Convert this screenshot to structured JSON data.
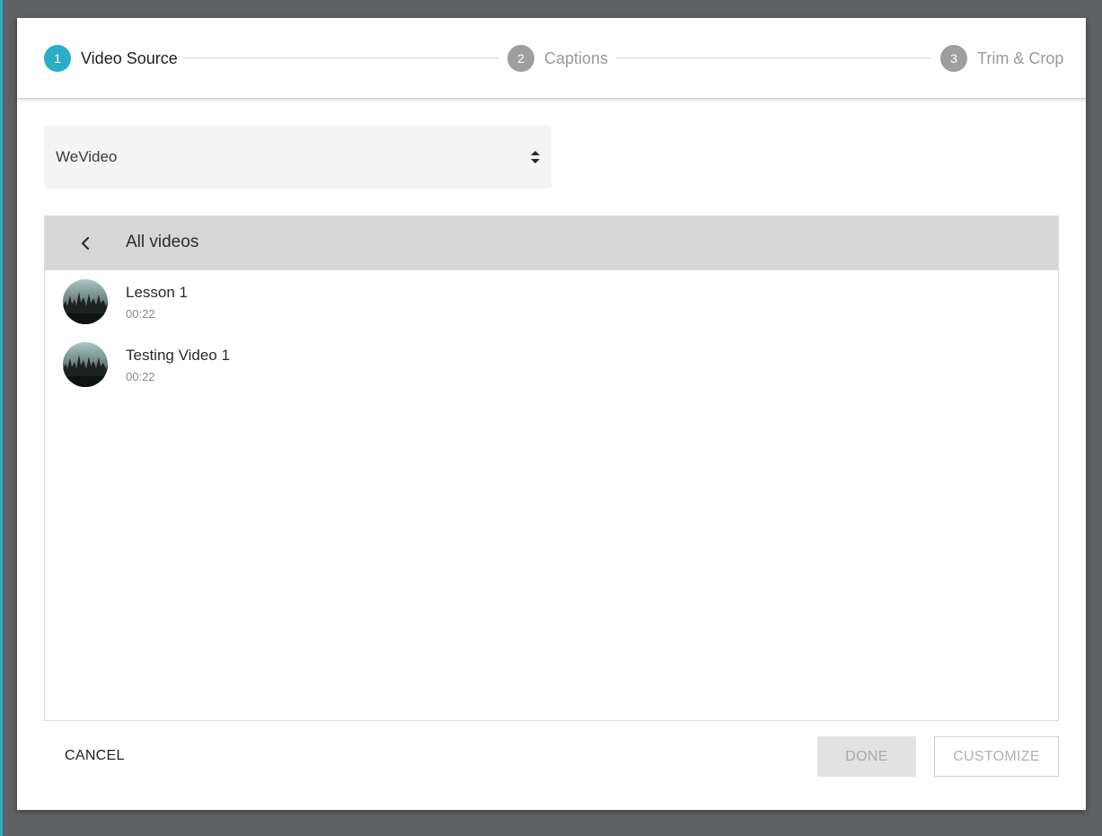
{
  "steps": [
    {
      "number": "1",
      "label": "Video Source",
      "active": true
    },
    {
      "number": "2",
      "label": "Captions",
      "active": false
    },
    {
      "number": "3",
      "label": "Trim & Crop",
      "active": false
    }
  ],
  "source": {
    "selected": "WeVideo"
  },
  "list": {
    "title": "All videos",
    "items": [
      {
        "title": "Lesson 1",
        "duration": "00:22"
      },
      {
        "title": "Testing Video 1",
        "duration": "00:22"
      }
    ]
  },
  "footer": {
    "cancel_label": "CANCEL",
    "done_label": "DONE",
    "customize_label": "CUSTOMIZE"
  },
  "colors": {
    "accent": "#2aaec5",
    "step_inactive": "#9e9e9e",
    "backdrop": "#5e6063"
  },
  "icons": {
    "back": "chevron-left-icon",
    "select": "sort-arrows-icon",
    "thumbnail": "video-thumbnail-image"
  }
}
